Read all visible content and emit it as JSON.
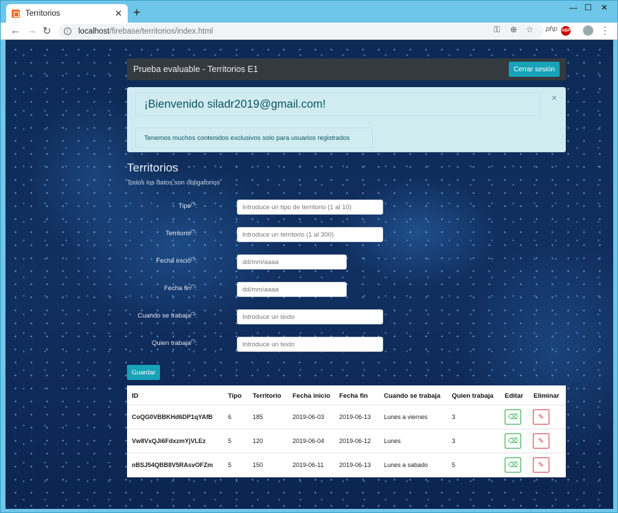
{
  "browser": {
    "tab_title": "Territorios",
    "new_tab": "+",
    "url_host": "localhost",
    "url_path": "/firebase/territorios/index.html",
    "ext_php": "php",
    "ext_abp": "ABP"
  },
  "navbar": {
    "brand": "Prueba evaluable - Territorios E1",
    "logout_label": "Cerrar sesión"
  },
  "alert": {
    "heading": "¡Bienvenido siladr2019@gmail.com!",
    "close": "×",
    "message": "Tenemos muchos contenidos exclusivos solo para usuarios registrados"
  },
  "form": {
    "title": "Territorios",
    "subtitle": "Todos los datos son obligatorios",
    "required_mark": "(*)",
    "fields": [
      {
        "label": "Tipo",
        "placeholder": "Introduce un tipo de territorio (1 al 10)"
      },
      {
        "label": "Territorio",
        "placeholder": "Introduce un territorio (1 al 300)"
      },
      {
        "label": "Fecha inicio",
        "placeholder": "dd/mm/aaaa"
      },
      {
        "label": "Fecha fin",
        "placeholder": "dd/mm/aaaa"
      },
      {
        "label": "Cuando se trabaja",
        "placeholder": "Introduce un texto"
      },
      {
        "label": "Quien trabaja",
        "placeholder": "Introduce un texto"
      }
    ],
    "save_label": "Guardar"
  },
  "table": {
    "headers": [
      "ID",
      "Tipo",
      "Territorio",
      "Fecha inicio",
      "Fecha fin",
      "Cuando se trabaja",
      "Quien trabaja",
      "Editar",
      "Eliminar"
    ],
    "rows": [
      [
        "CoQG0VBBKHd6DP1qYAfB",
        "6",
        "185",
        "2019-06-03",
        "2019-06-13",
        "Lunes a viernes",
        "3"
      ],
      [
        "Vw8VxQJi6FdxzmYjVLEz",
        "5",
        "120",
        "2019-06-04",
        "2019-06-12",
        "Lunes",
        "3"
      ],
      [
        "nBSJ54QBB8V5RAsvOFZm",
        "5",
        "150",
        "2019-06-11",
        "2019-06-13",
        "Lunes a sabado",
        "5"
      ]
    ]
  },
  "icons": {
    "edit": "eraser-icon",
    "delete": "edit-square-icon"
  }
}
